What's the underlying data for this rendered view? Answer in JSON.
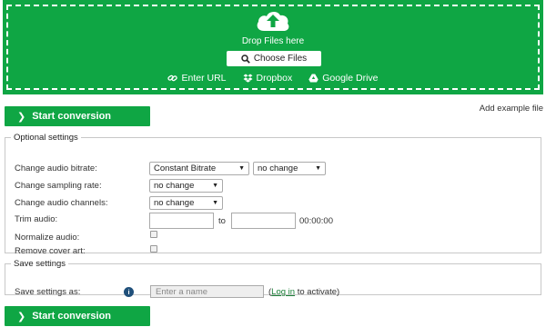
{
  "drop_zone": {
    "icon": "cloud-upload-icon",
    "drop_text": "Drop Files here",
    "choose_label": "Choose Files",
    "sources": [
      {
        "label": "Enter URL",
        "icon": "link-icon"
      },
      {
        "label": "Dropbox",
        "icon": "dropbox-icon"
      },
      {
        "label": "Google Drive",
        "icon": "google-drive-icon"
      }
    ]
  },
  "start_button_label": "Start conversion",
  "add_example_label": "Add example file",
  "optional": {
    "legend": "Optional settings",
    "bitrate_label": "Change audio bitrate:",
    "bitrate_mode": "Constant Bitrate",
    "bitrate_value": "no change",
    "sampling_label": "Change sampling rate:",
    "sampling_value": "no change",
    "channels_label": "Change audio channels:",
    "channels_value": "no change",
    "trim_label": "Trim audio:",
    "trim_to": "to",
    "trim_time": "00:00:00",
    "normalize_label": "Normalize audio:",
    "remove_cover_label": "Remove cover art:"
  },
  "save": {
    "legend": "Save settings",
    "label": "Save settings as:",
    "placeholder": "Enter a name",
    "login_prefix": "(",
    "login_link": "Log in",
    "login_suffix": " to activate)"
  },
  "colors": {
    "accent": "#0fa644",
    "info": "#1f4f7a",
    "link": "#1a7f37"
  }
}
